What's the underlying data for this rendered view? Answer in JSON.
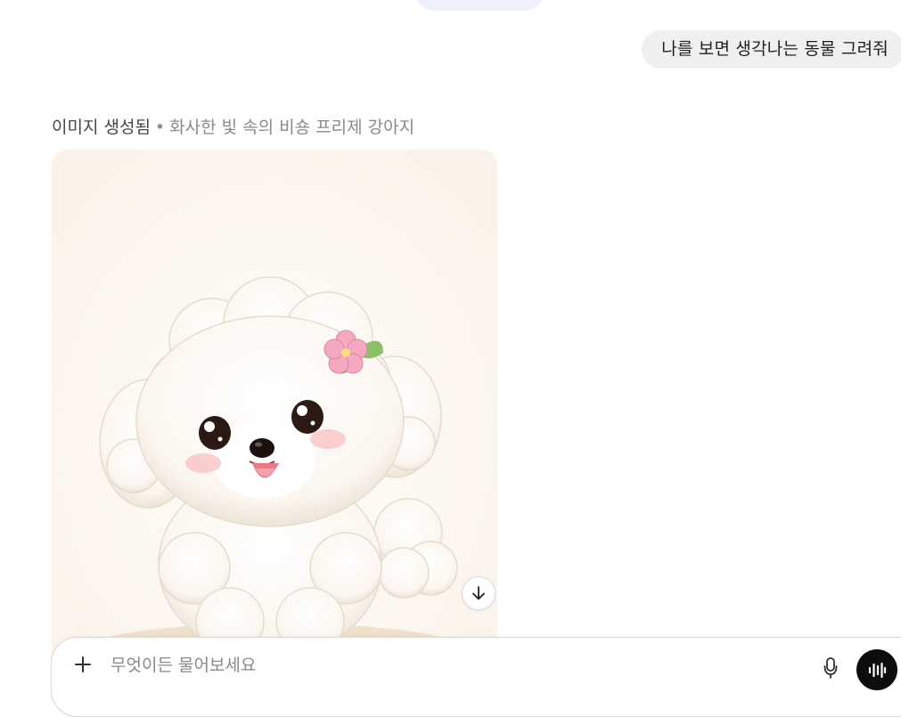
{
  "user_message": {
    "text": "나를 보면 생각나는 동물 그려줘"
  },
  "response": {
    "status_label": "이미지 생성됨",
    "separator": "•",
    "image_title": "화사한 빛 속의 비숑 프리제 강아지",
    "image": {
      "subject": "bichon-frise-puppy-illustration",
      "accessory": "pink-flower",
      "colors": {
        "background": "#fcf8f3",
        "fur": "#fffdf9",
        "flower": "#f4a9c0",
        "leaf": "#8bbf68"
      }
    },
    "download_icon": "arrow-down-icon"
  },
  "composer": {
    "placeholder": "무엇이든 물어보세요",
    "plus_icon": "plus-icon",
    "mic_icon": "mic-icon",
    "voice_icon": "voice-mode-icon"
  }
}
